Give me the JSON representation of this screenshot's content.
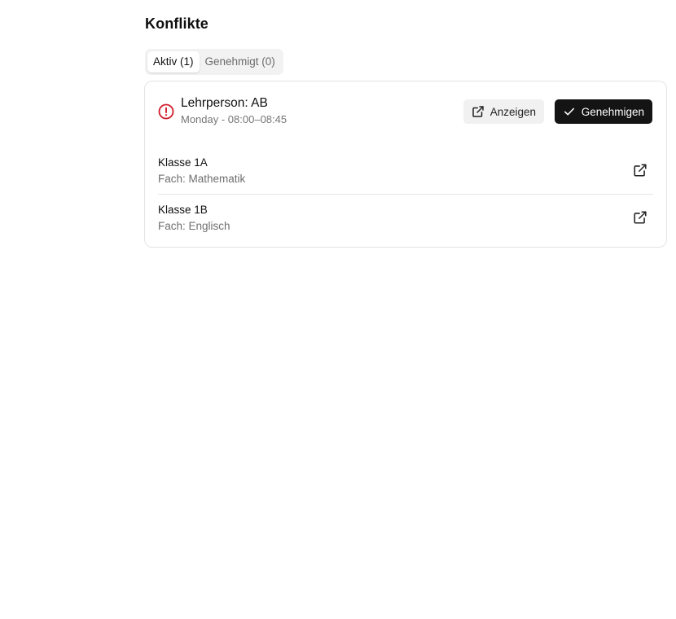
{
  "page": {
    "title": "Konflikte"
  },
  "tabs": [
    {
      "label": "Aktiv (1)",
      "active": true
    },
    {
      "label": "Genehmigt (0)",
      "active": false
    }
  ],
  "conflict": {
    "title": "Lehrperson: AB",
    "subtitle": "Monday - 08:00–08:45",
    "status_icon": "alert-circle-icon",
    "status_color": "#d11a2a",
    "actions": {
      "view_label": "Anzeigen",
      "view_icon": "external-link-icon",
      "approve_label": "Genehmigen",
      "approve_icon": "check-icon"
    },
    "items": [
      {
        "class_label": "Klasse 1A",
        "subject_label": "Fach: Mathematik",
        "link_icon": "external-link-icon"
      },
      {
        "class_label": "Klasse 1B",
        "subject_label": "Fach: Englisch",
        "link_icon": "external-link-icon"
      }
    ]
  },
  "colors": {
    "primary_button": "#141414",
    "secondary_button": "#f1f1f1",
    "tab_track": "#f2f2f2",
    "card_border": "#e4e4e4",
    "muted_text": "#767676"
  }
}
